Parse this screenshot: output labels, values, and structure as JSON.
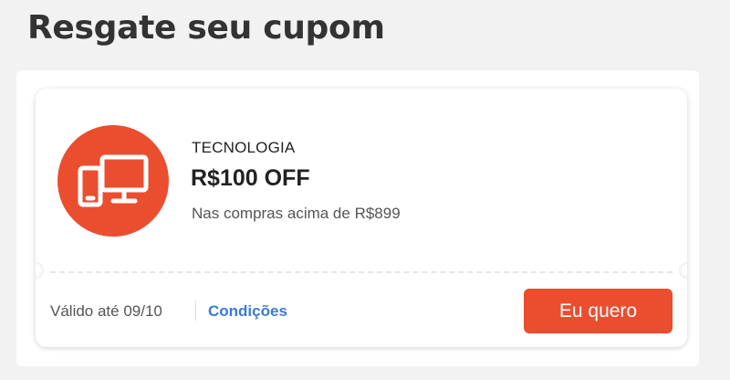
{
  "header": {
    "title": "Resgate seu cupom"
  },
  "coupon": {
    "icon": "devices-icon",
    "category": "TECNOLOGIA",
    "discount": "R$100 OFF",
    "condition": "Nas compras acima de R$899",
    "validity": "Válido até 09/10",
    "conditions_link": "Condições",
    "cta_label": "Eu quero"
  },
  "colors": {
    "accent": "#ea4e2f",
    "link": "#3a7bd5",
    "background": "#f2f2f2"
  }
}
